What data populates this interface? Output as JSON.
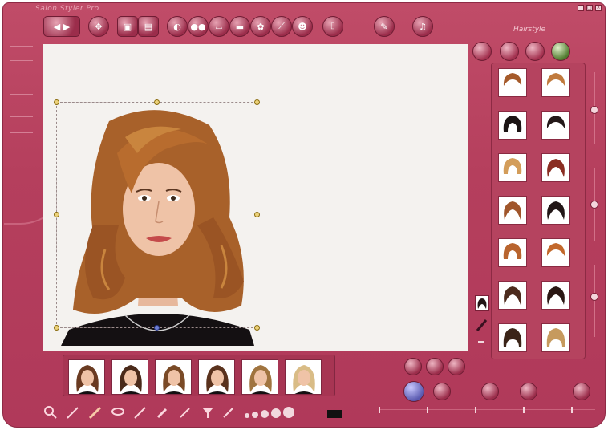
{
  "window": {
    "title": "Salon Styler Pro",
    "brand": "Hairstyle"
  },
  "window_controls": [
    "_",
    "□",
    "×"
  ],
  "hair_library": {
    "items": [
      {
        "style": "short-auburn",
        "color": "#a55a2a"
      },
      {
        "style": "short-light",
        "color": "#c07a3d"
      },
      {
        "style": "bob-black",
        "color": "#1b1414"
      },
      {
        "style": "pixie-black",
        "color": "#241919"
      },
      {
        "style": "bob-blonde",
        "color": "#d39d5a"
      },
      {
        "style": "long-red",
        "color": "#8a2d22"
      },
      {
        "style": "medium-auburn",
        "color": "#a0562b"
      },
      {
        "style": "updo-black",
        "color": "#221717"
      },
      {
        "style": "bob-copper",
        "color": "#b8642e"
      },
      {
        "style": "short-copper",
        "color": "#c2682b"
      },
      {
        "style": "long-brown",
        "color": "#4c2b1d"
      },
      {
        "style": "long-black",
        "color": "#2a1713"
      },
      {
        "style": "fringe-dark",
        "color": "#3b2418"
      },
      {
        "style": "fringe-blonde",
        "color": "#c69a5e"
      }
    ]
  },
  "thumbnails": [
    {
      "hair": "#6a3b22"
    },
    {
      "hair": "#4a2a1a"
    },
    {
      "hair": "#7a4a26"
    },
    {
      "hair": "#5a321d"
    },
    {
      "hair": "#a0743f"
    },
    {
      "hair": "#d9bc86"
    }
  ],
  "colors": {
    "frame": "#b53f5d",
    "canvas": "#f4f2ef",
    "hair_main": "#a8612a",
    "hair_highlight": "#c9853e"
  }
}
